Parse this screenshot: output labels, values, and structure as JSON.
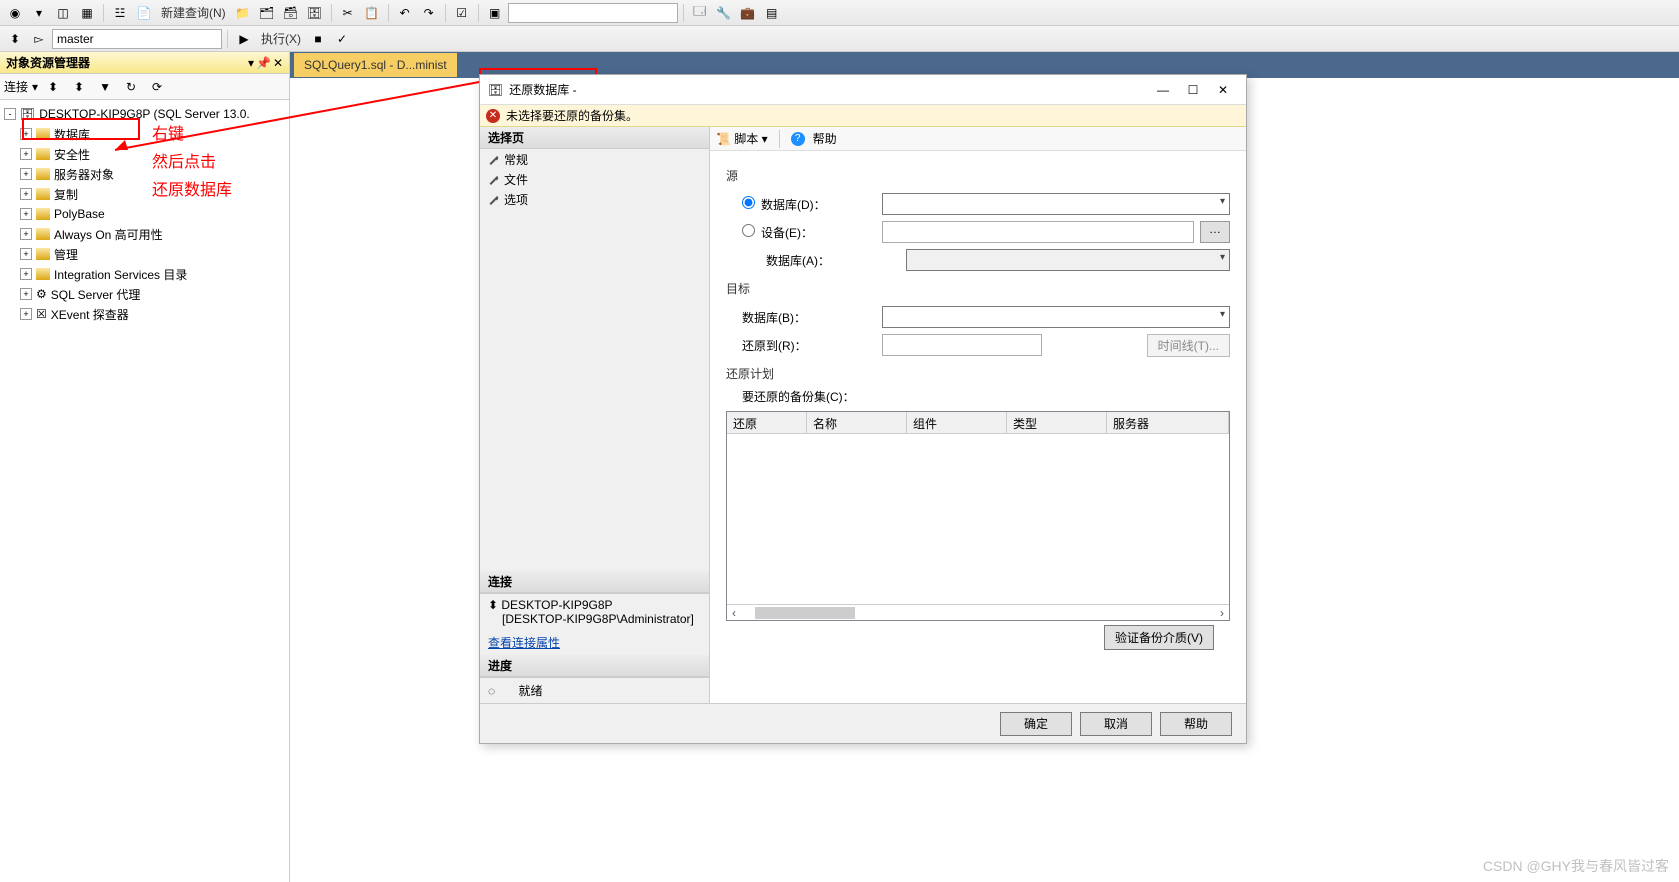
{
  "toolbar": {
    "new_query": "新建查询(N)",
    "execute": "执行(X)",
    "db_combo": "master"
  },
  "explorer": {
    "title": "对象资源管理器",
    "connect": "连接",
    "server": "DESKTOP-KIP9G8P (SQL Server 13.0.",
    "nodes": [
      "数据库",
      "安全性",
      "服务器对象",
      "复制",
      "PolyBase",
      "Always On 高可用性",
      "管理",
      "Integration Services 目录",
      "SQL Server 代理",
      "XEvent 探查器"
    ]
  },
  "annotations": {
    "l1": "右键",
    "l2": "然后点击",
    "l3": "还原数据库"
  },
  "editor": {
    "tab": "SQLQuery1.sql - D...minist"
  },
  "dialog": {
    "title": "还原数据库 -",
    "warn": "未选择要还原的备份集。",
    "pages_header": "选择页",
    "pages": [
      "常规",
      "文件",
      "选项"
    ],
    "conn_header": "连接",
    "conn_server": "DESKTOP-KIP9G8P",
    "conn_user": "[DESKTOP-KIP9G8P\\Administrator]",
    "view_conn": "查看连接属性",
    "progress_header": "进度",
    "progress_status": "就绪",
    "script": "脚本",
    "help": "帮助",
    "src_label": "源",
    "src_db": "数据库(D)：",
    "src_device": "设备(E)：",
    "src_devdb": "数据库(A)：",
    "target_label": "目标",
    "target_db": "数据库(B)：",
    "target_restore": "还原到(R)：",
    "timeline": "时间线(T)...",
    "plan_label": "还原计划",
    "plan_sets": "要还原的备份集(C)：",
    "cols": [
      "还原",
      "名称",
      "组件",
      "类型",
      "服务器"
    ],
    "verify": "验证备份介质(V)",
    "ok": "确定",
    "cancel": "取消",
    "help2": "帮助"
  },
  "watermark": "CSDN @GHY我与春风皆过客"
}
